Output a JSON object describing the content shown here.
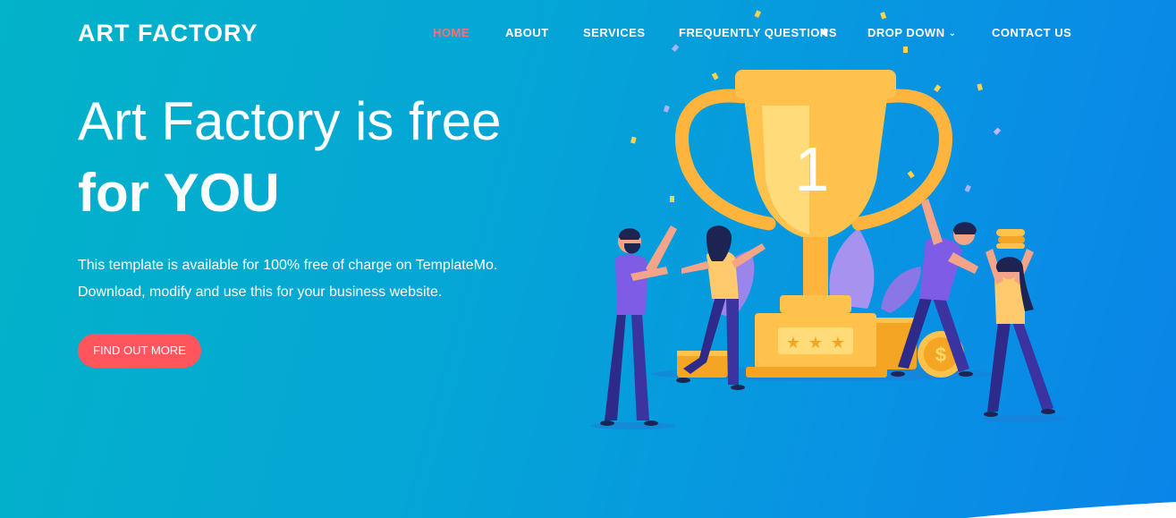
{
  "brand": {
    "logo_text": "ART FACTORY"
  },
  "nav": {
    "items": [
      {
        "label": "HOME",
        "active": true
      },
      {
        "label": "ABOUT",
        "active": false
      },
      {
        "label": "SERVICES",
        "active": false
      },
      {
        "label": "FREQUENTLY QUESTIONS",
        "active": false
      },
      {
        "label": "DROP DOWN",
        "active": false,
        "has_dropdown": true
      },
      {
        "label": "CONTACT US",
        "active": false
      }
    ],
    "dropdown_icon": "chevron-down-icon"
  },
  "hero": {
    "title_line1": "Art Factory is free",
    "title_line2": "for YOU",
    "text_line1": "This template is available for 100% free of charge on TemplateMo.",
    "text_line2": "Download, modify and use this for your business website.",
    "cta_label": "FIND OUT MORE"
  },
  "illustration": {
    "trophy_number": "1",
    "icon": "trophy-illustration"
  },
  "colors": {
    "gradient_start": "#03b3c8",
    "gradient_end": "#0a84e8",
    "accent": "#ff565e",
    "active_nav": "#ff6d75",
    "trophy_gold": "#ffc24c"
  }
}
